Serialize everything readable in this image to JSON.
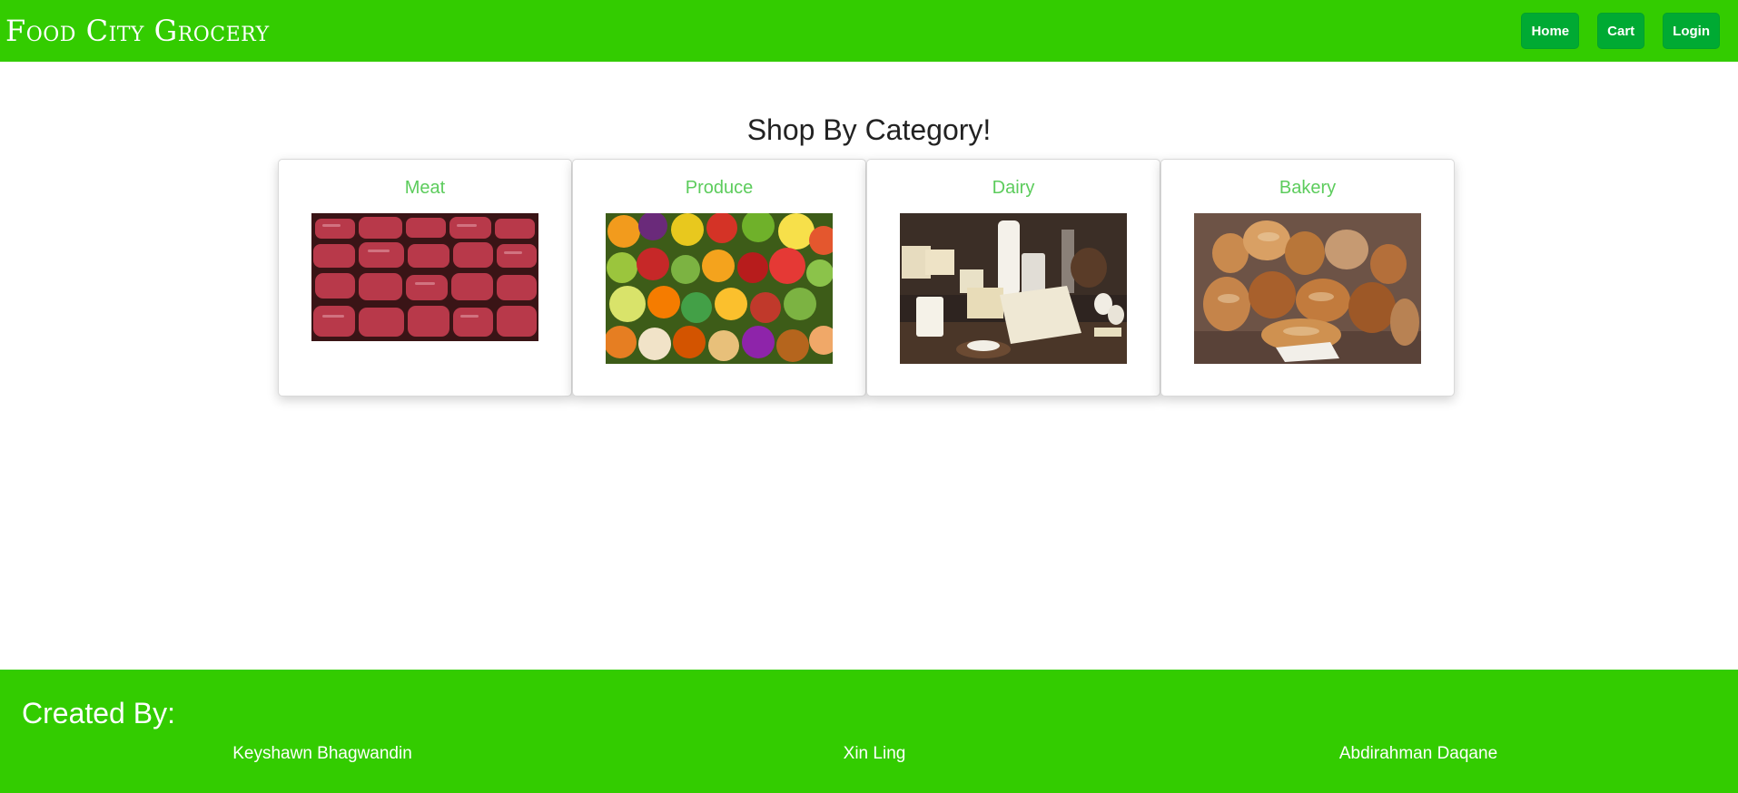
{
  "header": {
    "brand": "Food City Grocery",
    "nav": [
      {
        "label": "Home"
      },
      {
        "label": "Cart"
      },
      {
        "label": "Login"
      }
    ]
  },
  "main": {
    "title": "Shop By Category!",
    "categories": [
      {
        "label": "Meat",
        "image": "meat-photo"
      },
      {
        "label": "Produce",
        "image": "produce-photo"
      },
      {
        "label": "Dairy",
        "image": "dairy-photo"
      },
      {
        "label": "Bakery",
        "image": "bakery-photo"
      }
    ]
  },
  "footer": {
    "heading": "Created By:",
    "authors": [
      "Keyshawn Bhagwandin",
      "Xin Ling",
      "Abdirahman Daqane"
    ]
  },
  "colors": {
    "brand_green": "#33cc00",
    "button_green": "#00aa33",
    "category_title": "#5ccc5c"
  }
}
